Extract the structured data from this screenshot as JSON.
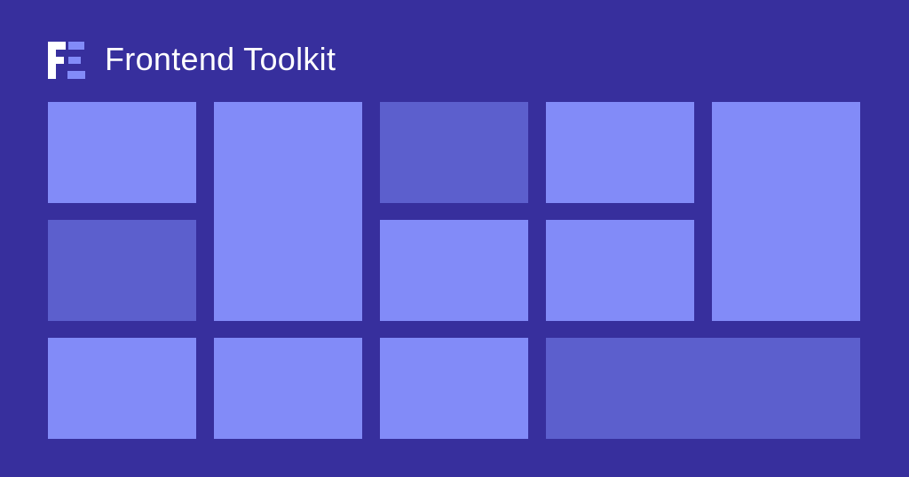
{
  "brand": {
    "title": "Frontend Toolkit",
    "logo_icon": "fe-monogram-icon"
  },
  "colors": {
    "background": "#372f9d",
    "tile_light": "#828bf8",
    "tile_dark": "#5c5fcd",
    "text": "#ffffff"
  }
}
